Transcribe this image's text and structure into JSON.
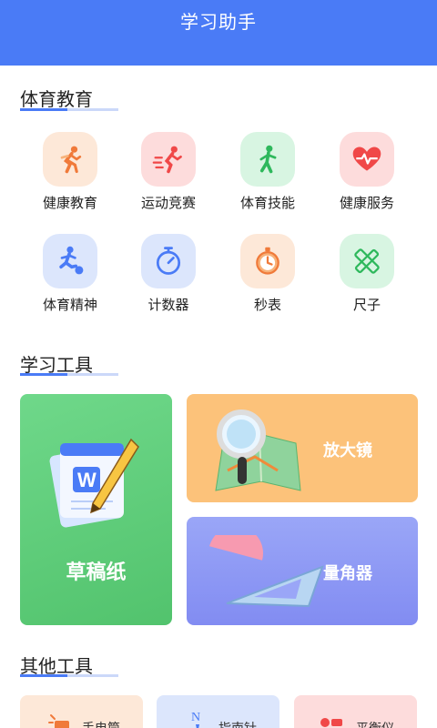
{
  "header": {
    "title": "学习助手"
  },
  "sections": {
    "sports": "体育教育",
    "study": "学习工具",
    "other": "其他工具"
  },
  "sports_items": [
    {
      "label": "健康教育",
      "icon": "running-icon",
      "bg": "#fde8d8"
    },
    {
      "label": "运动竞赛",
      "icon": "sprint-icon",
      "bg": "#fddcdc"
    },
    {
      "label": "体育技能",
      "icon": "exercise-icon",
      "bg": "#d8f5e2"
    },
    {
      "label": "健康服务",
      "icon": "heart-pulse-icon",
      "bg": "#fddcdc"
    },
    {
      "label": "体育精神",
      "icon": "soccer-icon",
      "bg": "#dce6fc"
    },
    {
      "label": "计数器",
      "icon": "timer-icon",
      "bg": "#dce6fc"
    },
    {
      "label": "秒表",
      "icon": "stopwatch-icon",
      "bg": "#fde8d8"
    },
    {
      "label": "尺子",
      "icon": "ruler-pencil-icon",
      "bg": "#d8f5e2"
    }
  ],
  "study_tools": {
    "draft": "草稿纸",
    "magnifier": "放大镜",
    "protractor": "量角器"
  },
  "other_tools": [
    {
      "label": "手电筒",
      "icon": "flashlight-icon"
    },
    {
      "label": "指南针",
      "icon": "compass-icon"
    },
    {
      "label": "平衡仪",
      "icon": "level-icon"
    }
  ],
  "colors": {
    "primary": "#4a7bf6",
    "draft_card": "#5fcf7a",
    "magnifier_card": "#fcc27a",
    "protractor_card": "#8e98f4"
  }
}
